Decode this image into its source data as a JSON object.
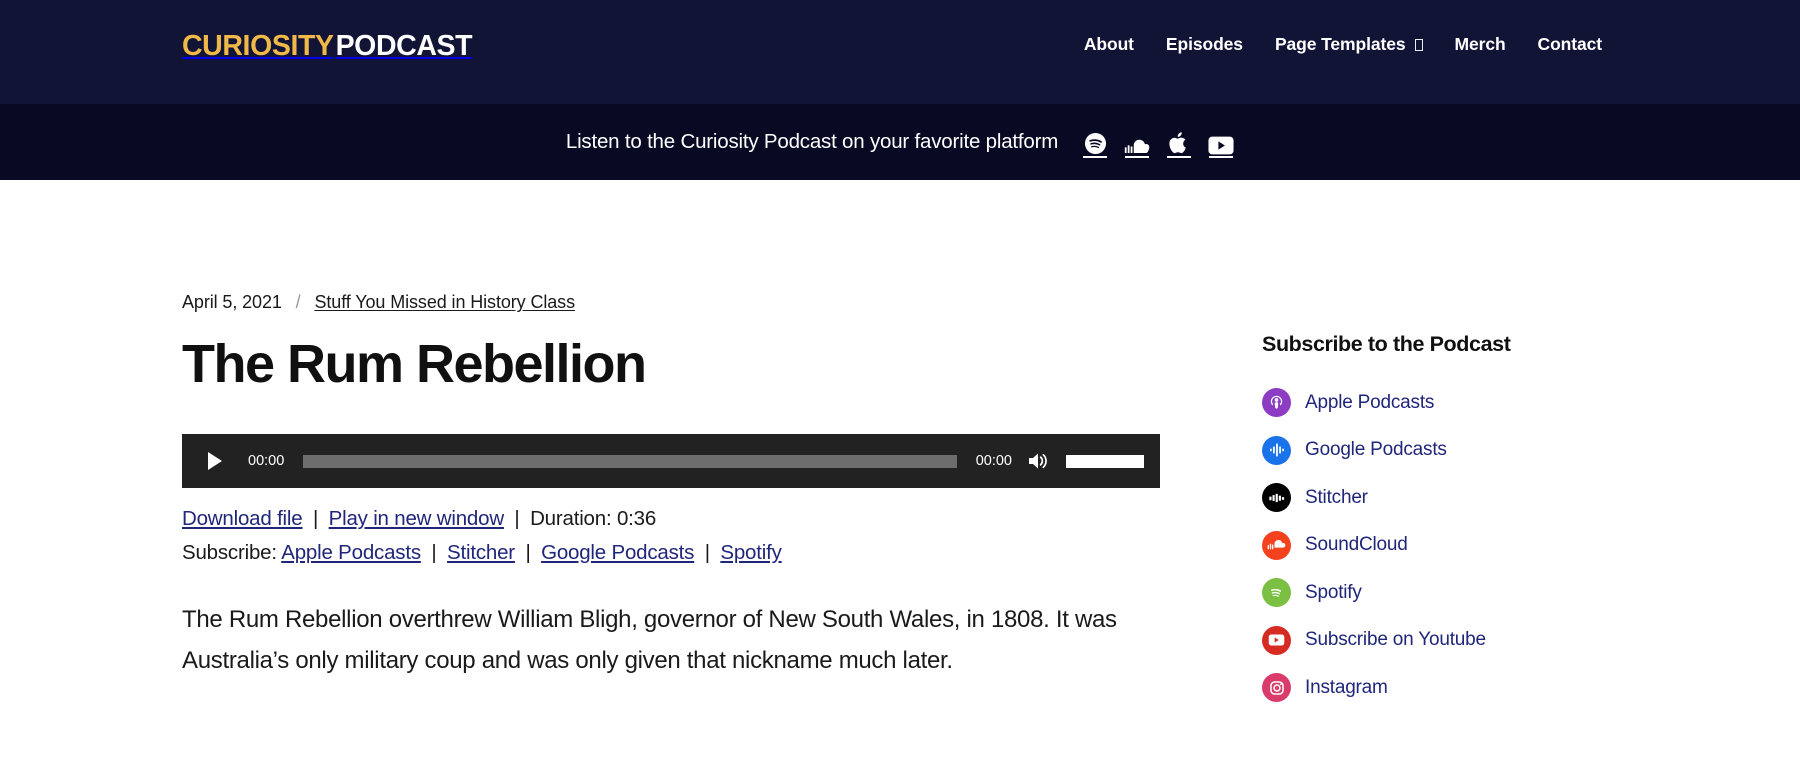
{
  "header": {
    "brand_primary": "CURIOSITY",
    "brand_secondary": "PODCAST",
    "nav": [
      {
        "label": "About",
        "icon": null
      },
      {
        "label": "Episodes",
        "icon": null
      },
      {
        "label": "Page Templates",
        "icon": "dropdown-box-icon"
      },
      {
        "label": "Merch",
        "icon": null
      },
      {
        "label": "Contact",
        "icon": null
      }
    ]
  },
  "banner": {
    "text": "Listen to the Curiosity Podcast on your favorite platform",
    "icons": [
      {
        "name": "spotify-icon",
        "label": "Spotify"
      },
      {
        "name": "soundcloud-icon",
        "label": "SoundCloud"
      },
      {
        "name": "apple-icon",
        "label": "Apple Podcasts"
      },
      {
        "name": "youtube-icon",
        "label": "YouTube"
      }
    ]
  },
  "post": {
    "date": "April 5, 2021",
    "separator": "/",
    "category": "Stuff You Missed in History Class",
    "title": "The Rum Rebellion",
    "excerpt": "The Rum Rebellion overthrew William Bligh, governor of New South Wales, in 1808. It was Australia’s only military coup and was only given that nickname much later."
  },
  "player": {
    "current_time": "00:00",
    "total_time": "00:00",
    "progress_percent": 0,
    "volume_percent": 100,
    "play_icon": "play-icon",
    "mute_icon": "speaker-icon"
  },
  "player_links": {
    "download": "Download file",
    "play_new_window": "Play in new window",
    "duration": "Duration: 0:36",
    "separator": "|",
    "subscribe_label": "Subscribe:",
    "subscribe_links": [
      "Apple Podcasts",
      "Stitcher",
      "Google Podcasts",
      "Spotify"
    ]
  },
  "sidebar": {
    "title": "Subscribe to the Podcast",
    "items": [
      {
        "label": "Apple Podcasts",
        "icon": "apple-podcasts-icon",
        "color": "#8d3cc4"
      },
      {
        "label": "Google Podcasts",
        "icon": "google-podcasts-icon",
        "color": "#1a73e8"
      },
      {
        "label": "Stitcher",
        "icon": "stitcher-icon",
        "color": "#000000"
      },
      {
        "label": "SoundCloud",
        "icon": "soundcloud-icon",
        "color": "#f4411e"
      },
      {
        "label": "Spotify",
        "icon": "spotify-icon",
        "color": "#7bc043"
      },
      {
        "label": "Subscribe on Youtube",
        "icon": "youtube-icon",
        "color": "#d62b23"
      },
      {
        "label": "Instagram",
        "icon": "instagram-icon",
        "color": "#d93c6a"
      }
    ]
  },
  "colors": {
    "header_bg": "#121436",
    "banner_bg": "#080a24",
    "brand_gold": "#f0b849",
    "link_navy": "#20267a",
    "player_bg": "#222222"
  }
}
